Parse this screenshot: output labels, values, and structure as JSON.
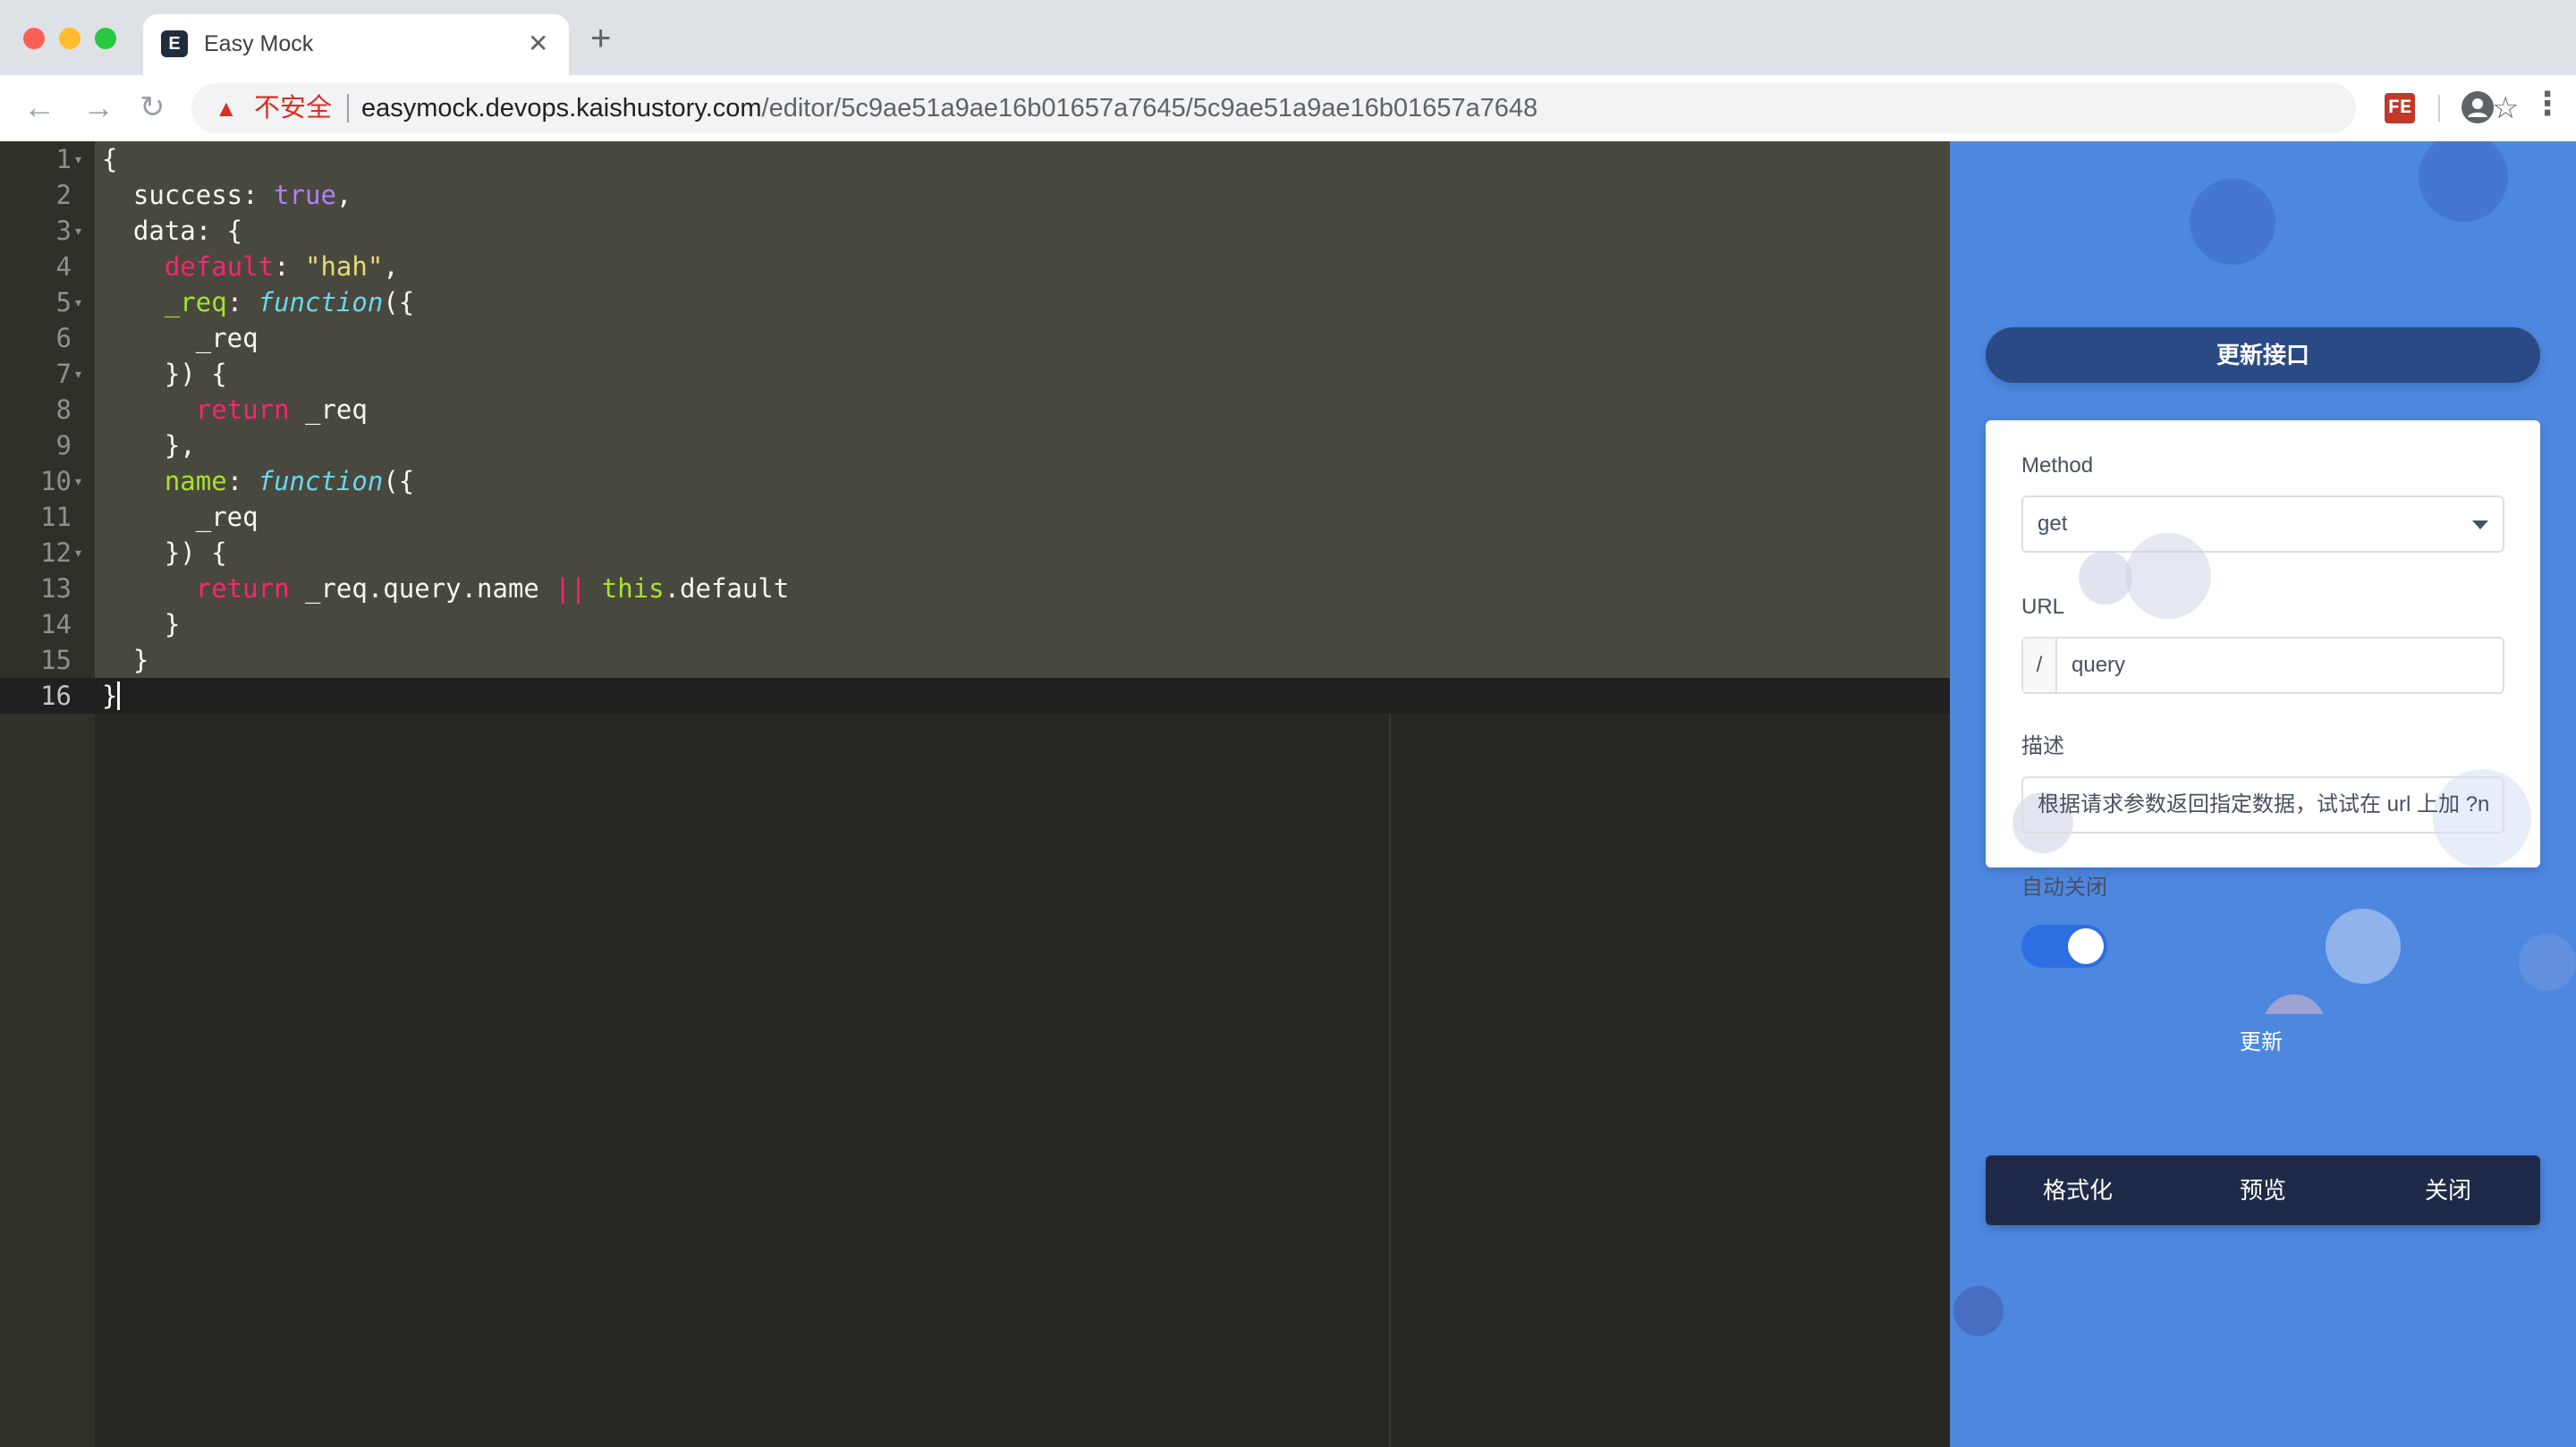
{
  "browser": {
    "tab_title": "Easy Mock",
    "tab_favicon_glyph": "E",
    "new_tab_glyph": "+",
    "close_glyph": "✕",
    "security_label": "不安全",
    "url_host": "easymock.devops.kaishustory.com",
    "url_path": "/editor/5c9ae51a9ae16b01657a7645/5c9ae51a9ae16b01657a7648",
    "extension_label": "FE",
    "icons": [
      "back-icon",
      "forward-icon",
      "reload-icon",
      "warning-icon",
      "star-icon",
      "extension-icon",
      "profile-icon",
      "menu-icon"
    ]
  },
  "editor": {
    "line_numbers": [
      "1",
      "2",
      "3",
      "4",
      "5",
      "6",
      "7",
      "8",
      "9",
      "10",
      "11",
      "12",
      "13",
      "14",
      "15",
      "16"
    ],
    "fold_lines": [
      "1",
      "3",
      "5",
      "7",
      "10",
      "12"
    ],
    "theme_colors": {
      "background": "#272822",
      "selection": "#49483e",
      "keyword": "#f92672",
      "storage": "#66d9ef",
      "string": "#e6db74",
      "constant": "#ae81ff"
    }
  },
  "panel": {
    "title": "更新接口",
    "method_label": "Method",
    "method_value": "get",
    "url_label": "URL",
    "url_prefix": "/",
    "url_value": "query",
    "desc_label": "描述",
    "desc_value": "根据请求参数返回指定数据，试试在 url 上加 ?n",
    "auto_close_label": "自动关闭",
    "auto_close_on": true,
    "submit_label": "更新",
    "actions": [
      "格式化",
      "预览",
      "关闭"
    ],
    "colors": {
      "background": "#4d87e0",
      "title_pill": "#2a4a85",
      "action_bar": "#1f2a48"
    }
  }
}
